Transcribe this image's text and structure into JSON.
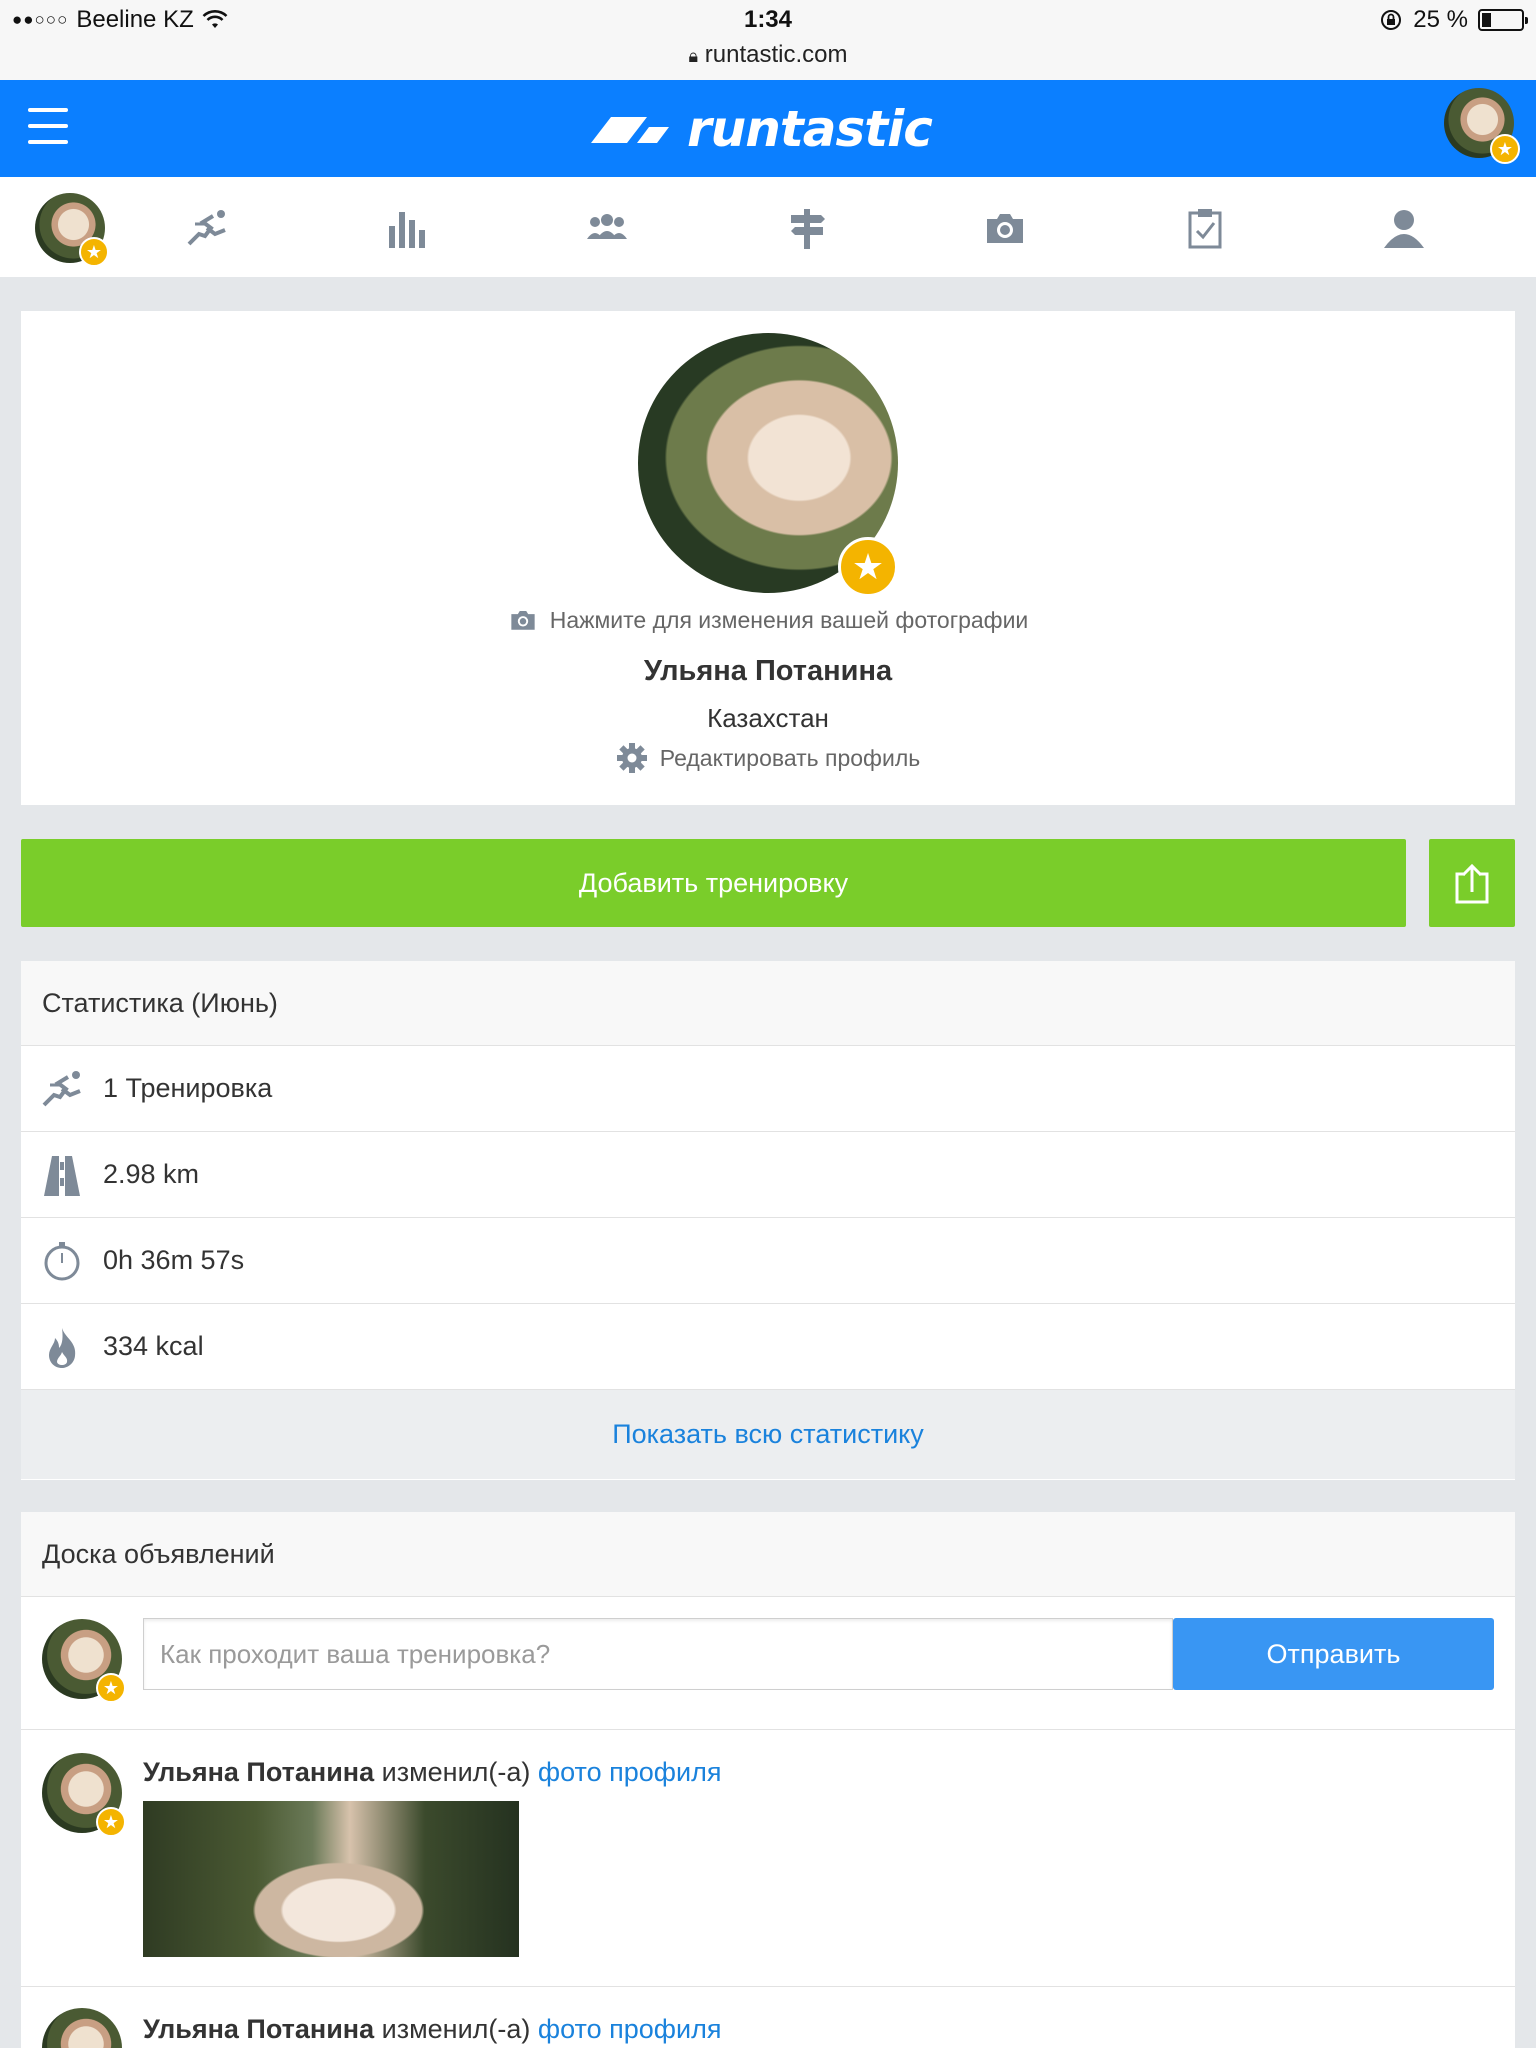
{
  "status_bar": {
    "signal": "●●○○○",
    "carrier": "Beeline KZ",
    "time": "1:34",
    "url": "runtastic.com",
    "battery": "25 %"
  },
  "header": {
    "logo": "runtastic",
    "brand_color": "#0b7fff"
  },
  "tabs": [
    {
      "name": "activity",
      "icon": "runner-icon"
    },
    {
      "name": "statistics",
      "icon": "bar-chart-icon"
    },
    {
      "name": "friends",
      "icon": "group-icon"
    },
    {
      "name": "routes",
      "icon": "signpost-icon"
    },
    {
      "name": "photos",
      "icon": "camera-icon"
    },
    {
      "name": "goals",
      "icon": "checklist-icon"
    },
    {
      "name": "profile",
      "icon": "person-icon"
    }
  ],
  "profile": {
    "change_photo_label": "Нажмите для изменения вашей фотографии",
    "name": "Ульяна Потанина",
    "country": "Казахстан",
    "edit_label": "Редактировать профиль"
  },
  "actions": {
    "add_workout_label": "Добавить тренировку",
    "accent_color": "#7acd2a"
  },
  "stats": {
    "title": "Статистика (Июнь)",
    "rows": [
      {
        "icon": "runner-icon",
        "value": "1 Тренировка"
      },
      {
        "icon": "road-icon",
        "value": "2.98 km"
      },
      {
        "icon": "stopwatch-icon",
        "value": "0h 36m 57s"
      },
      {
        "icon": "flame-icon",
        "value": "334 kcal"
      }
    ],
    "show_all_label": "Показать всю статистику"
  },
  "board": {
    "title": "Доска объявлений",
    "input_placeholder": "Как проходит ваша тренировка?",
    "send_label": "Отправить",
    "feed": [
      {
        "author": "Ульяна Потанина",
        "action": " изменил(-а) ",
        "link": "фото профиля"
      },
      {
        "author": "Ульяна Потанина",
        "action": " изменил(-а) ",
        "link": "фото профиля"
      }
    ]
  }
}
